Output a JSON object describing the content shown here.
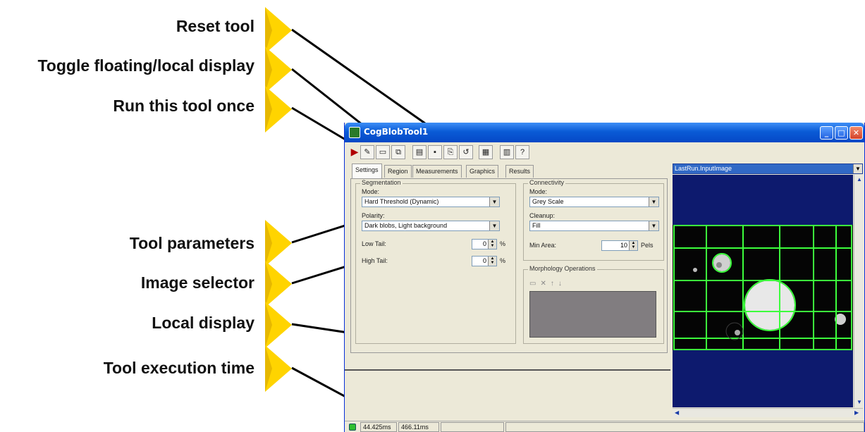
{
  "callouts": [
    {
      "label": "Reset tool"
    },
    {
      "label": "Toggle floating/local display"
    },
    {
      "label": "Run this tool once"
    },
    {
      "label": "Tool parameters"
    },
    {
      "label": "Image selector"
    },
    {
      "label": "Local display"
    },
    {
      "label": "Tool execution time"
    }
  ],
  "colors": {
    "callout_arrow": "#ffd400",
    "titlebar": "#0a5bd6",
    "display_bg": "#0d1a6e",
    "graphics_green": "#3cff3c"
  },
  "window": {
    "title": "CogBlobTool1",
    "controls": {
      "minimize": "_",
      "maximize": "□",
      "close": "✕"
    },
    "toolbar": [
      "run-icon",
      "edit-icon",
      "display-icon",
      "float-icon",
      "open-icon",
      "save-icon",
      "copy-icon",
      "reset-icon",
      "grid-icon",
      "help-icon"
    ],
    "tabs": [
      {
        "label": "Settings"
      },
      {
        "label": "Region"
      },
      {
        "label": "Measurements"
      },
      {
        "label": "Graphics"
      },
      {
        "label": "Results"
      }
    ],
    "segmentation": {
      "title": "Segmentation",
      "mode_label": "Mode:",
      "mode_value": "Hard Threshold (Dynamic)",
      "polarity_label": "Polarity:",
      "polarity_value": "Dark blobs, Light background",
      "low_tail_label": "Low Tail:",
      "low_tail_value": "0",
      "high_tail_label": "High Tail:",
      "high_tail_value": "0",
      "unit": "%"
    },
    "connectivity": {
      "title": "Connectivity",
      "mode_label": "Mode:",
      "mode_value": "Grey Scale",
      "cleanup_label": "Cleanup:",
      "cleanup_value": "Fill",
      "min_area_label": "Min Area:",
      "min_area_value": "10",
      "min_area_unit": "Pels"
    },
    "morphology": {
      "title": "Morphology Operations"
    },
    "image_selector": {
      "value": "LastRun.InputImage"
    },
    "status": {
      "time1": "44.425ms",
      "time2": "466.11ms"
    }
  }
}
